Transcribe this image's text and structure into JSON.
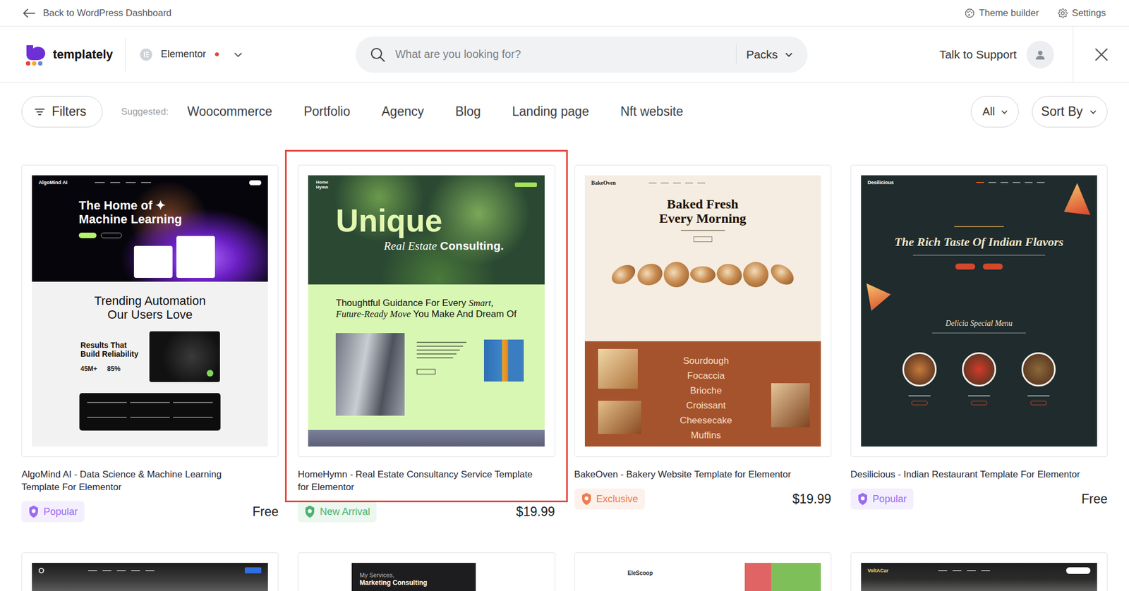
{
  "topbar": {
    "back": "Back to WordPress Dashboard",
    "theme_builder": "Theme builder",
    "settings": "Settings"
  },
  "header": {
    "logo": "templately",
    "builder": "Elementor",
    "search": {
      "placeholder": "What are you looking for?",
      "scope": "Packs"
    },
    "support": "Talk to Support"
  },
  "filters": {
    "button": "Filters",
    "suggested_label": "Suggested:",
    "suggested": [
      "Woocommerce",
      "Portfolio",
      "Agency",
      "Blog",
      "Landing page",
      "Nft website"
    ],
    "type": "All",
    "sort": "Sort By"
  },
  "cards": [
    {
      "title": "AlgoMind AI - Data Science & Machine Learning Template For Elementor",
      "badge": {
        "label": "Popular",
        "color": "#9b6bf2"
      },
      "price": "Free",
      "highlighted": false,
      "preview": {
        "kind": "ai",
        "brand": "AlgoMind AI",
        "headline": [
          "The Home of ✦",
          "Machine Learning"
        ],
        "section": [
          "Trending Automation",
          "Our Users Love"
        ],
        "feature": [
          "Results That",
          "Build Reliability"
        ],
        "stats": [
          "45M+",
          "85%"
        ]
      }
    },
    {
      "title": "HomeHymn - Real Estate Consultancy Service Template for Elementor",
      "badge": {
        "label": "New Arrival",
        "color": "#4cb36f"
      },
      "price": "$19.99",
      "highlighted": true,
      "preview": {
        "kind": "real-estate",
        "brand": "Home Hymn",
        "headline": "Unique",
        "subhead": [
          {
            "text": "Real Estate",
            "italic": true
          },
          {
            "text": " Consulting.",
            "italic": false
          }
        ],
        "body": [
          {
            "text": "Thoughtful Guidance For Every ",
            "italic": false
          },
          {
            "text": "Smart, ",
            "italic": true
          },
          {
            "text": "Future-Ready Move",
            "italic": true
          },
          {
            "text": " You Make And Dream Of",
            "italic": false
          }
        ]
      }
    },
    {
      "title": "BakeOven - Bakery Website Template for Elementor",
      "badge": {
        "label": "Exclusive",
        "color": "#ee7b4f"
      },
      "price": "$19.99",
      "highlighted": false,
      "preview": {
        "kind": "bakery",
        "brand": "BakeOven",
        "headline": [
          "Baked Fresh",
          "Every Morning"
        ],
        "menu": [
          "Sourdough",
          "Focaccia",
          "Brioche",
          "Croissant",
          "Cheesecake",
          "Muffins"
        ]
      }
    },
    {
      "title": "Desilicious - Indian Restaurant Template For Elementor",
      "badge": {
        "label": "Popular",
        "color": "#9b6bf2"
      },
      "price": "Free",
      "highlighted": false,
      "preview": {
        "kind": "restaurant",
        "brand": "Desilicious",
        "headline": "The Rich Taste Of Indian Flavors",
        "section": "Delicia Special Menu"
      }
    }
  ],
  "more_cards": [
    {
      "preview": {
        "kind": "event"
      }
    },
    {
      "preview": {
        "kind": "marketing",
        "lines": [
          "My Services,",
          "Marketing Consulting"
        ]
      }
    },
    {
      "preview": {
        "kind": "magazine",
        "brand": "EleScoop"
      }
    },
    {
      "preview": {
        "kind": "car",
        "brand": "VoltACar"
      }
    }
  ]
}
